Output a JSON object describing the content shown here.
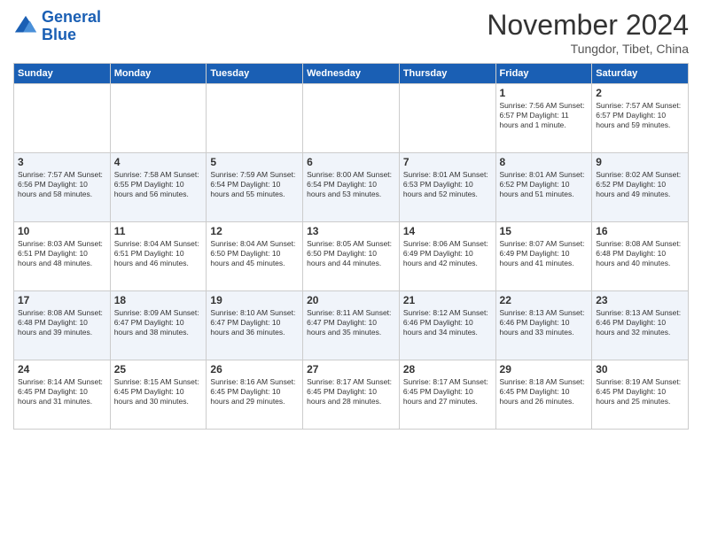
{
  "header": {
    "logo_line1": "General",
    "logo_line2": "Blue",
    "month": "November 2024",
    "location": "Tungdor, Tibet, China"
  },
  "days_of_week": [
    "Sunday",
    "Monday",
    "Tuesday",
    "Wednesday",
    "Thursday",
    "Friday",
    "Saturday"
  ],
  "weeks": [
    [
      {
        "day": "",
        "info": ""
      },
      {
        "day": "",
        "info": ""
      },
      {
        "day": "",
        "info": ""
      },
      {
        "day": "",
        "info": ""
      },
      {
        "day": "",
        "info": ""
      },
      {
        "day": "1",
        "info": "Sunrise: 7:56 AM\nSunset: 6:57 PM\nDaylight: 11 hours\nand 1 minute."
      },
      {
        "day": "2",
        "info": "Sunrise: 7:57 AM\nSunset: 6:57 PM\nDaylight: 10 hours\nand 59 minutes."
      }
    ],
    [
      {
        "day": "3",
        "info": "Sunrise: 7:57 AM\nSunset: 6:56 PM\nDaylight: 10 hours\nand 58 minutes."
      },
      {
        "day": "4",
        "info": "Sunrise: 7:58 AM\nSunset: 6:55 PM\nDaylight: 10 hours\nand 56 minutes."
      },
      {
        "day": "5",
        "info": "Sunrise: 7:59 AM\nSunset: 6:54 PM\nDaylight: 10 hours\nand 55 minutes."
      },
      {
        "day": "6",
        "info": "Sunrise: 8:00 AM\nSunset: 6:54 PM\nDaylight: 10 hours\nand 53 minutes."
      },
      {
        "day": "7",
        "info": "Sunrise: 8:01 AM\nSunset: 6:53 PM\nDaylight: 10 hours\nand 52 minutes."
      },
      {
        "day": "8",
        "info": "Sunrise: 8:01 AM\nSunset: 6:52 PM\nDaylight: 10 hours\nand 51 minutes."
      },
      {
        "day": "9",
        "info": "Sunrise: 8:02 AM\nSunset: 6:52 PM\nDaylight: 10 hours\nand 49 minutes."
      }
    ],
    [
      {
        "day": "10",
        "info": "Sunrise: 8:03 AM\nSunset: 6:51 PM\nDaylight: 10 hours\nand 48 minutes."
      },
      {
        "day": "11",
        "info": "Sunrise: 8:04 AM\nSunset: 6:51 PM\nDaylight: 10 hours\nand 46 minutes."
      },
      {
        "day": "12",
        "info": "Sunrise: 8:04 AM\nSunset: 6:50 PM\nDaylight: 10 hours\nand 45 minutes."
      },
      {
        "day": "13",
        "info": "Sunrise: 8:05 AM\nSunset: 6:50 PM\nDaylight: 10 hours\nand 44 minutes."
      },
      {
        "day": "14",
        "info": "Sunrise: 8:06 AM\nSunset: 6:49 PM\nDaylight: 10 hours\nand 42 minutes."
      },
      {
        "day": "15",
        "info": "Sunrise: 8:07 AM\nSunset: 6:49 PM\nDaylight: 10 hours\nand 41 minutes."
      },
      {
        "day": "16",
        "info": "Sunrise: 8:08 AM\nSunset: 6:48 PM\nDaylight: 10 hours\nand 40 minutes."
      }
    ],
    [
      {
        "day": "17",
        "info": "Sunrise: 8:08 AM\nSunset: 6:48 PM\nDaylight: 10 hours\nand 39 minutes."
      },
      {
        "day": "18",
        "info": "Sunrise: 8:09 AM\nSunset: 6:47 PM\nDaylight: 10 hours\nand 38 minutes."
      },
      {
        "day": "19",
        "info": "Sunrise: 8:10 AM\nSunset: 6:47 PM\nDaylight: 10 hours\nand 36 minutes."
      },
      {
        "day": "20",
        "info": "Sunrise: 8:11 AM\nSunset: 6:47 PM\nDaylight: 10 hours\nand 35 minutes."
      },
      {
        "day": "21",
        "info": "Sunrise: 8:12 AM\nSunset: 6:46 PM\nDaylight: 10 hours\nand 34 minutes."
      },
      {
        "day": "22",
        "info": "Sunrise: 8:13 AM\nSunset: 6:46 PM\nDaylight: 10 hours\nand 33 minutes."
      },
      {
        "day": "23",
        "info": "Sunrise: 8:13 AM\nSunset: 6:46 PM\nDaylight: 10 hours\nand 32 minutes."
      }
    ],
    [
      {
        "day": "24",
        "info": "Sunrise: 8:14 AM\nSunset: 6:45 PM\nDaylight: 10 hours\nand 31 minutes."
      },
      {
        "day": "25",
        "info": "Sunrise: 8:15 AM\nSunset: 6:45 PM\nDaylight: 10 hours\nand 30 minutes."
      },
      {
        "day": "26",
        "info": "Sunrise: 8:16 AM\nSunset: 6:45 PM\nDaylight: 10 hours\nand 29 minutes."
      },
      {
        "day": "27",
        "info": "Sunrise: 8:17 AM\nSunset: 6:45 PM\nDaylight: 10 hours\nand 28 minutes."
      },
      {
        "day": "28",
        "info": "Sunrise: 8:17 AM\nSunset: 6:45 PM\nDaylight: 10 hours\nand 27 minutes."
      },
      {
        "day": "29",
        "info": "Sunrise: 8:18 AM\nSunset: 6:45 PM\nDaylight: 10 hours\nand 26 minutes."
      },
      {
        "day": "30",
        "info": "Sunrise: 8:19 AM\nSunset: 6:45 PM\nDaylight: 10 hours\nand 25 minutes."
      }
    ]
  ]
}
